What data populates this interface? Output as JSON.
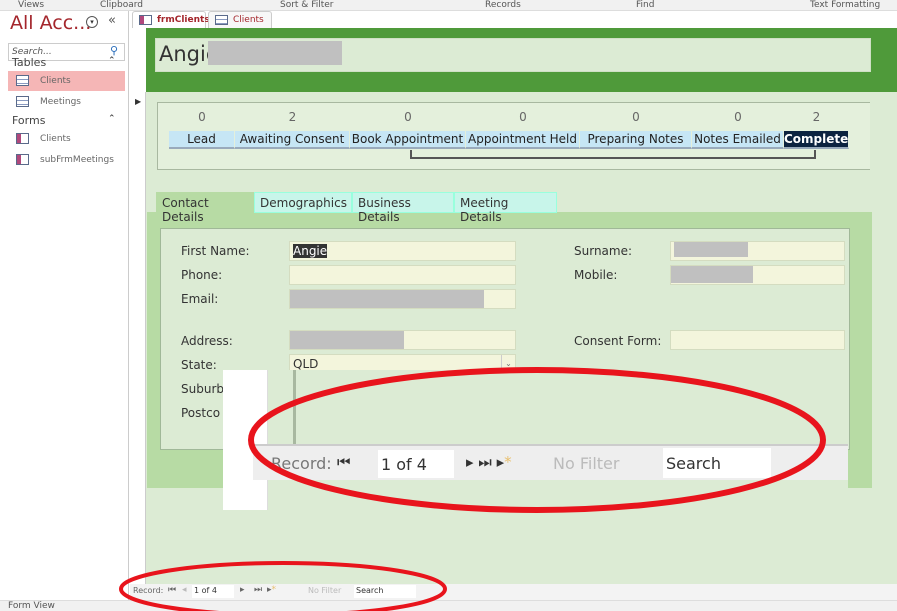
{
  "ribbon": {
    "groups": [
      "Views",
      "Clipboard",
      "Sort & Filter",
      "Records",
      "Find",
      "Text Formatting"
    ]
  },
  "nav": {
    "title": "All Acc...",
    "search_placeholder": "Search...",
    "sections": [
      {
        "label": "Tables",
        "items": [
          "Clients",
          "Meetings"
        ]
      },
      {
        "label": "Forms",
        "items": [
          "Clients",
          "subFrmMeetings"
        ]
      }
    ]
  },
  "doc_tabs": [
    "frmClients",
    "Clients"
  ],
  "form": {
    "title": "Angie",
    "stages": [
      {
        "label": "Lead",
        "count": "0"
      },
      {
        "label": "Awaiting Consent",
        "count": "2"
      },
      {
        "label": "Book Appointment",
        "count": "0"
      },
      {
        "label": "Appointment Held",
        "count": "0"
      },
      {
        "label": "Preparing Notes",
        "count": "0"
      },
      {
        "label": "Notes Emailed",
        "count": "0"
      },
      {
        "label": "Complete",
        "count": "2"
      }
    ],
    "tabs": [
      "Contact Details",
      "Demographics",
      "Business Details",
      "Meeting Details"
    ],
    "fields": {
      "first_name_label": "First Name:",
      "first_name": "Angie",
      "surname_label": "Surname:",
      "phone_label": "Phone:",
      "mobile_label": "Mobile:",
      "email_label": "Email:",
      "address_label": "Address:",
      "consent_label": "Consent Form:",
      "state_label": "State:",
      "state": "QLD",
      "suburb_label": "Suburb",
      "postcode_label": "Postco"
    }
  },
  "record_nav": {
    "label": "Record:",
    "position": "1 of 4",
    "filter": "No Filter",
    "search": "Search"
  },
  "status": {
    "view": "Form View"
  },
  "colors": {
    "header": "#4f9a3a",
    "form_bg": "#dcebd4",
    "active_stage": "#0c2340",
    "annotation": "#e8141c"
  }
}
